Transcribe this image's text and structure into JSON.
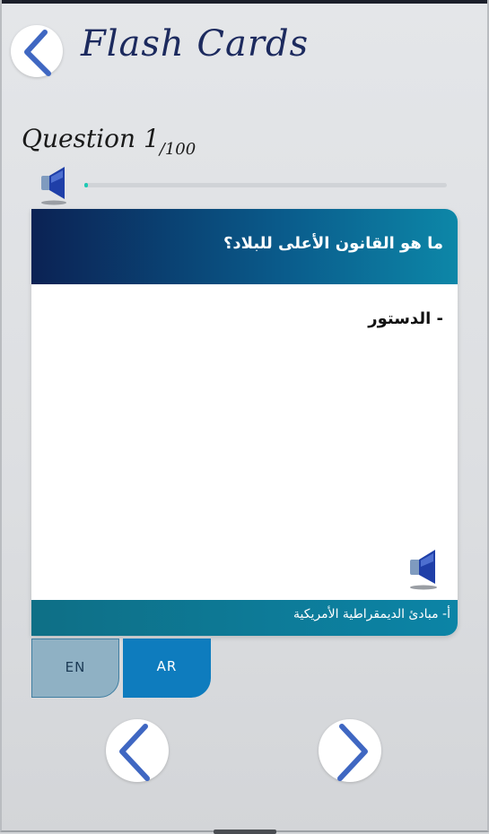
{
  "header": {
    "title": "Flash Cards",
    "back_icon": "chevron-left-icon"
  },
  "question_counter": {
    "label": "Question",
    "current": "1",
    "total": "/100",
    "progress_fraction": 0.01
  },
  "card": {
    "question": "ما هو القانون الأعلى للبلاد؟",
    "answer": "- الدستور",
    "category": "أ- مبادئ الديمقراطية الأمريكية",
    "speaker_icon": "speaker-icon"
  },
  "languages": [
    {
      "label": "EN",
      "selected": false
    },
    {
      "label": "AR",
      "selected": true
    }
  ],
  "navigation": {
    "prev_icon": "chevron-left-icon",
    "next_icon": "chevron-right-icon"
  },
  "colors": {
    "accent": "#0e7cbe",
    "header_gradient_start": "#0b2254",
    "header_gradient_end": "#0d87a8",
    "progress": "#1ec9b4",
    "chevron": "#3f67c2"
  }
}
